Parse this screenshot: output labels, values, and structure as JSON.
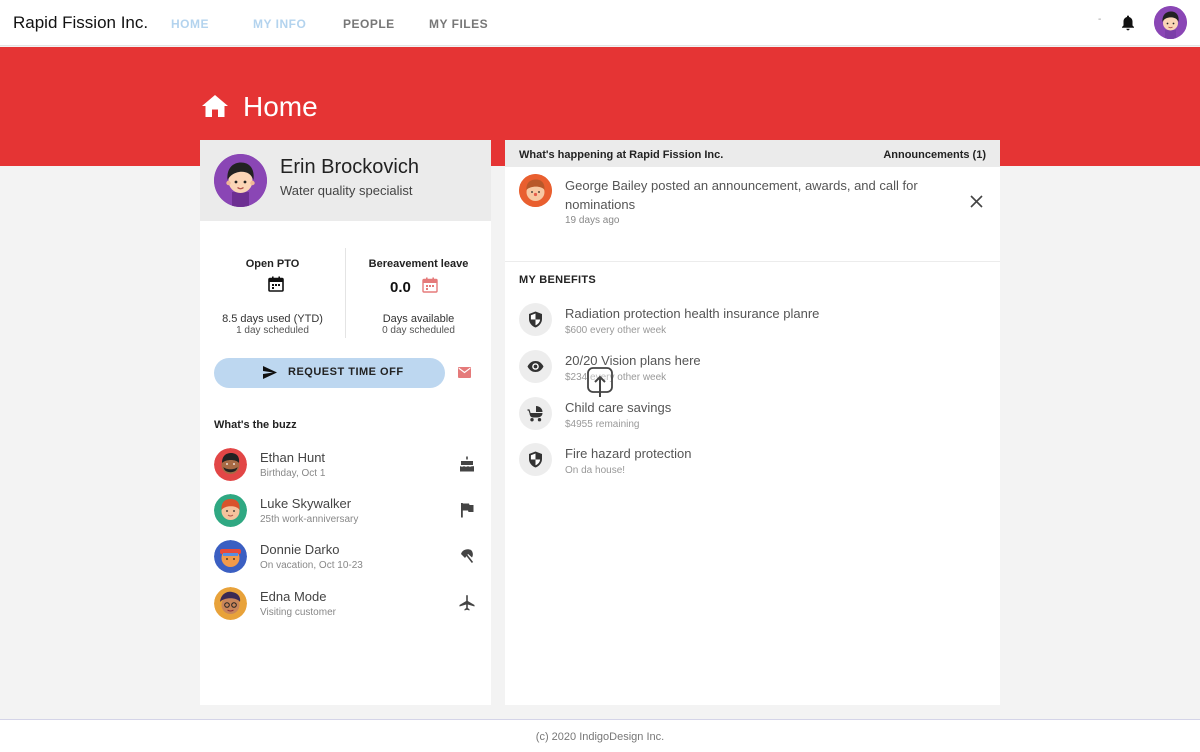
{
  "app": {
    "brand": "Rapid Fission Inc."
  },
  "nav": {
    "items": [
      {
        "label": "HOME",
        "active": true
      },
      {
        "label": "MY INFO",
        "active": true
      },
      {
        "label": "PEOPLE",
        "active": false
      },
      {
        "label": "MY FILES",
        "active": false
      }
    ],
    "dash": "-"
  },
  "banner": {
    "title": "Home",
    "color": "#e53434"
  },
  "profile": {
    "name": "Erin Brockovich",
    "role": "Water quality specialist"
  },
  "leave": {
    "pto": {
      "title": "Open PTO",
      "line1": "8.5 days used (YTD)",
      "line2": "1 day scheduled"
    },
    "bereavement": {
      "title": "Bereavement leave",
      "value": "0.0",
      "line1": "Days available",
      "line2": "0 day scheduled"
    }
  },
  "request_button": {
    "label": "REQUEST TIME OFF"
  },
  "buzz": {
    "title": "What's the buzz",
    "items": [
      {
        "name": "Ethan Hunt",
        "sub": "Birthday, Oct 1",
        "icon": "cake-icon"
      },
      {
        "name": "Luke Skywalker",
        "sub": "25th work-anniversary",
        "icon": "flag-icon"
      },
      {
        "name": "Donnie Darko",
        "sub": "On vacation, Oct 10-23",
        "icon": "beach-umbrella-icon"
      },
      {
        "name": "Edna Mode",
        "sub": "Visiting customer",
        "icon": "airplane-icon"
      }
    ]
  },
  "news": {
    "title": "What's happening at Rapid Fission Inc.",
    "count": "Announcements (1)",
    "announcement": {
      "text": "George Bailey posted an announcement, awards, and call for nominations",
      "time": "19 days ago"
    }
  },
  "benefits": {
    "title": "MY BENEFITS",
    "items": [
      {
        "name": "Radiation protection health insurance planre",
        "sub": "$600 every other week",
        "icon": "shield-icon"
      },
      {
        "name": "20/20 Vision plans here",
        "sub": "$234 every other week",
        "icon": "eye-icon"
      },
      {
        "name": "Child care savings",
        "sub": "$4955 remaining",
        "icon": "stroller-icon"
      },
      {
        "name": "Fire hazard protection",
        "sub": "On da house!",
        "icon": "shield-icon"
      }
    ]
  },
  "footer": {
    "text": "(c) 2020 IndigoDesign Inc."
  },
  "colors": {
    "accent": "#e53434",
    "button": "#bdd7f0",
    "nav_active": "#b3d3ee"
  }
}
